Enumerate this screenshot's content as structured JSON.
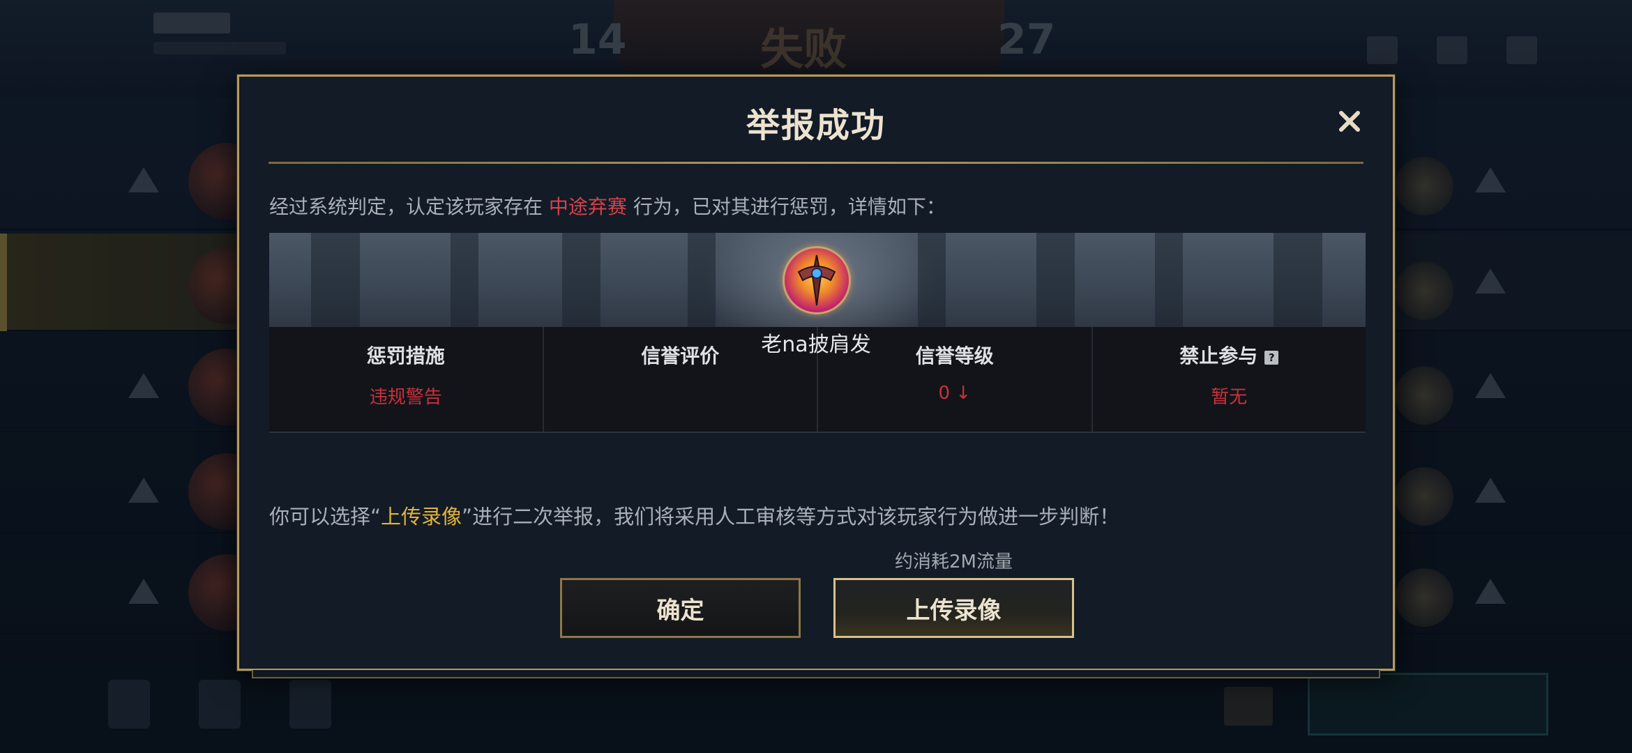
{
  "background": {
    "score_left": "14",
    "score_right": "27",
    "result": "失败"
  },
  "dialog": {
    "title": "举报成功",
    "intro_prefix": "经过系统判定，认定该玩家存在 ",
    "intro_highlight": "中途弃赛",
    "intro_suffix": " 行为，已对其进行惩罚，详情如下：",
    "player_name": "老na披肩发",
    "stats": [
      {
        "label": "惩罚措施",
        "value": "违规警告"
      },
      {
        "label": "信誉评价",
        "value": ""
      },
      {
        "label": "信誉等级",
        "value": "0 ↓"
      },
      {
        "label": "禁止参与",
        "value": "暂无",
        "help": "?"
      }
    ],
    "notice_prefix": "你可以选择“",
    "notice_highlight": "上传录像",
    "notice_suffix": "”进行二次举报，我们将采用人工审核等方式对该玩家行为做进一步判断！",
    "data_usage_note": "约消耗2M流量",
    "confirm_label": "确定",
    "upload_label": "上传录像"
  },
  "colors": {
    "accent_gold": "#b39a60",
    "warning_red": "#d8414a",
    "highlight_gold": "#e4b43a",
    "dialog_bg": "#121b26"
  },
  "icons": {
    "close": "close-icon",
    "help": "help-icon",
    "avatar": "player-avatar"
  }
}
